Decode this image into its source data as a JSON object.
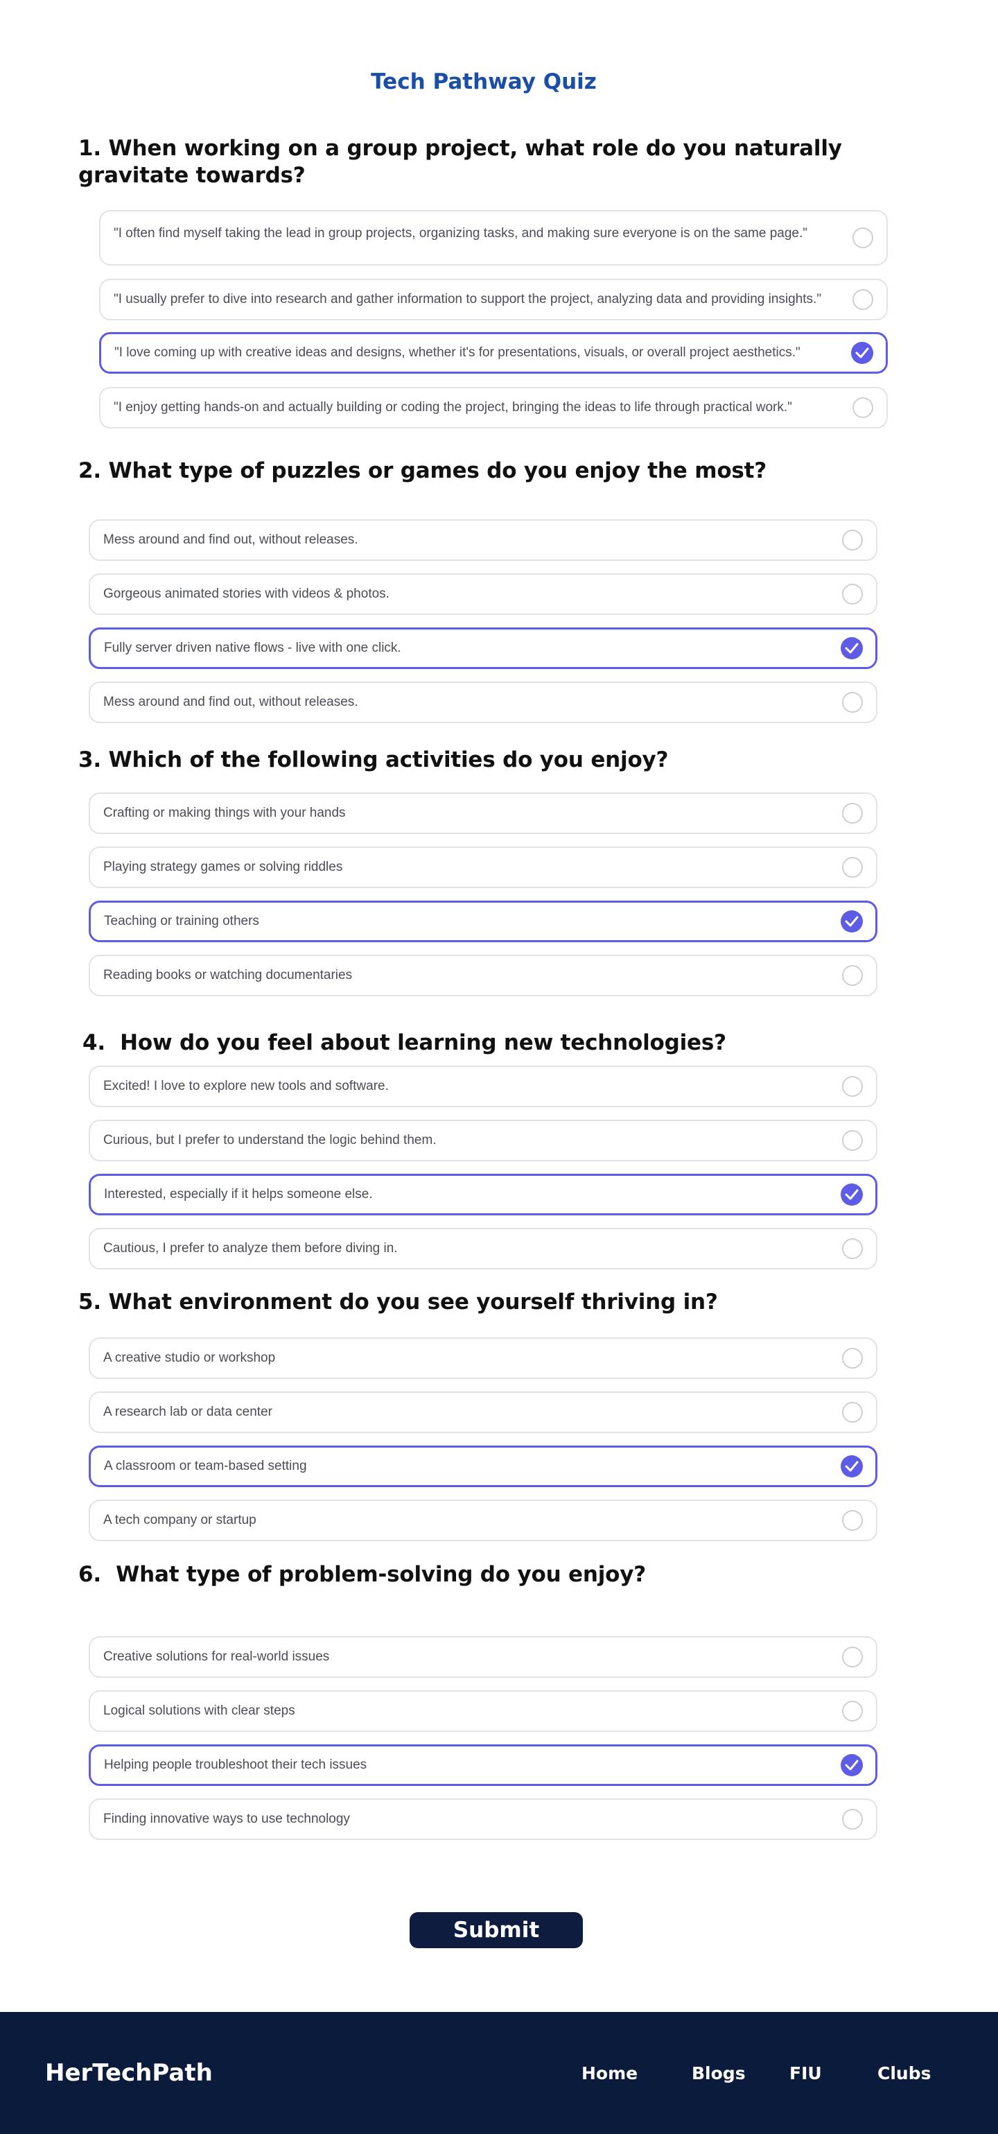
{
  "page": {
    "title": "Tech Pathway Quiz"
  },
  "colors": {
    "accent": "#5e5ce6",
    "title": "#1a4ea8",
    "footer_bg": "#0b1b3c",
    "button_bg": "#0d1c3f",
    "border": "#e3e3e6"
  },
  "questions": [
    {
      "title_line1": "1. When working on a group project, what role do you naturally",
      "title_line2": "gravitate towards?",
      "options": [
        {
          "label": "\"I often find myself taking the lead in group projects, organizing tasks, and making sure everyone is on the same page.\"",
          "selected": false
        },
        {
          "label": "\"I usually prefer to dive into research and gather information to support the project, analyzing data and providing insights.\"",
          "selected": false
        },
        {
          "label": "\"I love coming up with creative ideas and designs, whether it's for presentations, visuals, or overall project aesthetics.\"",
          "selected": true
        },
        {
          "label": "\"I enjoy getting hands-on and actually building or coding the project, bringing the ideas to life through practical work.\"",
          "selected": false
        }
      ]
    },
    {
      "title": "2. What type of puzzles or games do you enjoy the most?",
      "options": [
        {
          "label": "Mess around and find out, without releases.",
          "selected": false
        },
        {
          "label": "Gorgeous animated stories with videos & photos.",
          "selected": false
        },
        {
          "label": "Fully server driven native flows - live with one click.",
          "selected": true
        },
        {
          "label": "Mess around and find out, without releases.",
          "selected": false
        }
      ]
    },
    {
      "title": "3. Which of the following activities do you enjoy?",
      "options": [
        {
          "label": "Crafting or making things with your hands",
          "selected": false
        },
        {
          "label": "Playing strategy games or solving riddles",
          "selected": false
        },
        {
          "label": "Teaching or training others",
          "selected": true
        },
        {
          "label": "Reading books or watching documentaries",
          "selected": false
        }
      ]
    },
    {
      "title": "4.  How do you feel about learning new technologies?",
      "options": [
        {
          "label": "Excited! I love to explore new tools and software.",
          "selected": false
        },
        {
          "label": "Curious, but I prefer to understand the logic behind them.",
          "selected": false
        },
        {
          "label": "Interested, especially if it helps someone else.",
          "selected": true
        },
        {
          "label": "Cautious, I prefer to analyze them before diving in.",
          "selected": false
        }
      ]
    },
    {
      "title": "5. What environment do you see yourself thriving in?",
      "options": [
        {
          "label": "A creative studio or workshop",
          "selected": false
        },
        {
          "label": "A research lab or data center",
          "selected": false
        },
        {
          "label": "A classroom or team-based setting",
          "selected": true
        },
        {
          "label": "A tech company or startup",
          "selected": false
        }
      ]
    },
    {
      "title": "6.  What type of problem-solving do you enjoy?",
      "options": [
        {
          "label": "Creative solutions for real-world issues",
          "selected": false
        },
        {
          "label": "Logical solutions with clear steps",
          "selected": false
        },
        {
          "label": "Helping people troubleshoot their tech issues",
          "selected": true
        },
        {
          "label": "Finding innovative ways to use technology",
          "selected": false
        }
      ]
    }
  ],
  "submit": {
    "label": "Submit"
  },
  "footer": {
    "brand": "HerTechPath",
    "nav": [
      "Home",
      "Blogs",
      "FIU",
      "Clubs"
    ]
  }
}
